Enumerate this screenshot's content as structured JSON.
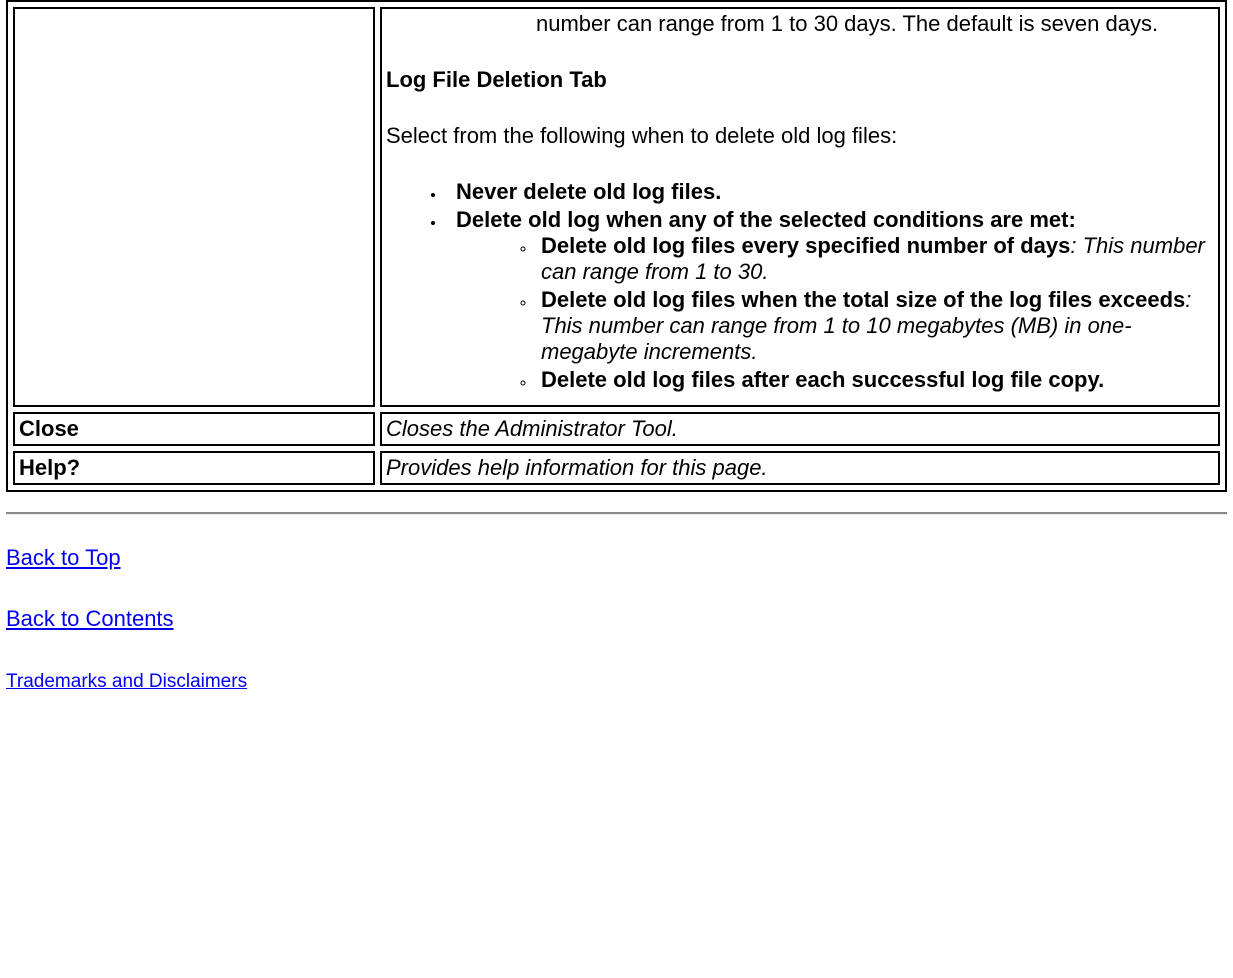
{
  "fragment": "number can range from 1 to 30 days. The default is seven days.",
  "logDeletion": {
    "heading": "Log File Deletion Tab",
    "intro": "Select from the following when to delete old log files:",
    "items": {
      "never": "Never delete old log files",
      "conditionsLabel": "Delete old log when any of the selected conditions are met:",
      "sub": {
        "daysBold": "Delete old log files every specified number of days",
        "daysDesc": ": This number can range from 1 to 30.",
        "sizeBold": "Delete old log files when the total size of the log files exceeds",
        "sizeDesc": ": This number can range from 1 to 10 megabytes (MB) in one-megabyte increments.",
        "successBold": "Delete old log files after each successful log file copy",
        "successDesc": "."
      }
    }
  },
  "rows": {
    "close": {
      "label": "Close",
      "desc": "Closes the Administrator Tool."
    },
    "help": {
      "label": "Help?",
      "desc": "Provides help information for this page."
    }
  },
  "links": {
    "backTop": "Back to Top",
    "backContents": "Back to Contents",
    "trademarks": "Trademarks and Disclaimers"
  }
}
